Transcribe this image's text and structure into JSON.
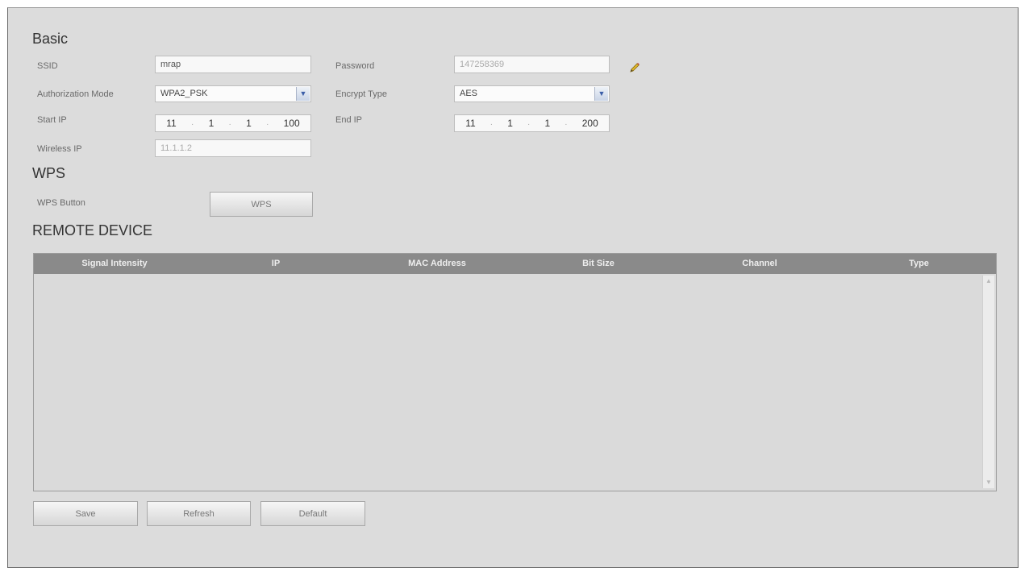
{
  "basic": {
    "title": "Basic",
    "ssid_label": "SSID",
    "ssid_value": "mrap",
    "password_label": "Password",
    "password_value": "147258369",
    "auth_mode_label": "Authorization Mode",
    "auth_mode_value": "WPA2_PSK",
    "encrypt_type_label": "Encrypt Type",
    "encrypt_type_value": "AES",
    "start_ip_label": "Start IP",
    "start_ip": [
      "11",
      "1",
      "1",
      "100"
    ],
    "end_ip_label": "End IP",
    "end_ip": [
      "11",
      "1",
      "1",
      "200"
    ],
    "wireless_ip_label": "Wireless IP",
    "wireless_ip_value": "11.1.1.2"
  },
  "wps": {
    "title": "WPS",
    "button_label_text": "WPS Button",
    "button_text": "WPS"
  },
  "remote_device": {
    "title": "REMOTE DEVICE",
    "columns": [
      "Signal Intensity",
      "IP",
      "MAC Address",
      "Bit Size",
      "Channel",
      "Type"
    ],
    "rows": []
  },
  "actions": {
    "save": "Save",
    "refresh": "Refresh",
    "default": "Default"
  },
  "icons": {
    "edit": "pencil-icon",
    "dropdown": "chevron-down-icon",
    "scroll_up": "arrow-up-icon",
    "scroll_down": "arrow-down-icon"
  },
  "colors": {
    "panel_bg": "#dcdcdc",
    "table_header": "#8a8a8a",
    "dropdown_accent": "#3b5ea8"
  }
}
